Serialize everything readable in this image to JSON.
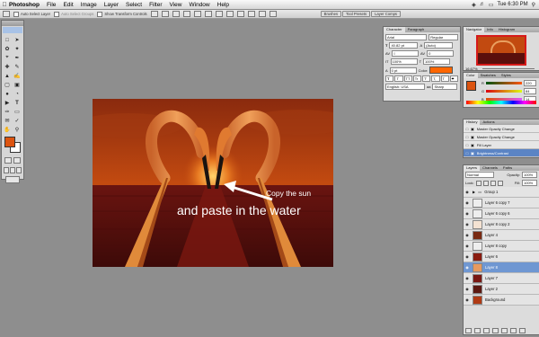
{
  "menubar": {
    "items": [
      "Photoshop",
      "File",
      "Edit",
      "Image",
      "Layer",
      "Select",
      "Filter",
      "View",
      "Window",
      "Help"
    ],
    "clock": "Tue 6:30 PM"
  },
  "optbar": {
    "auto_select_layer": "Auto Select Layer",
    "auto_select_groups": "Auto Select Groups",
    "show_transform": "Show Transform Controls",
    "wells": [
      "Brushes",
      "Tool Presets",
      "Layer Comps"
    ]
  },
  "canvas": {
    "colors": {
      "sky": "#c24a10",
      "water": "#5a0f0c",
      "flamingo": "#e88a3a"
    },
    "caption1": "Copy the sun",
    "caption2": "and paste in the water"
  },
  "character": {
    "tabs": [
      "Character",
      "Paragraph"
    ],
    "font": "Arial",
    "style": "Regular",
    "size": "40.82 pt",
    "leading": "(Auto)",
    "tracking": "0",
    "kerning": "0",
    "scale_v": "100%",
    "scale_h": "100%",
    "baseline": "0 pt",
    "color_label": "Color:",
    "color": "#ff6600",
    "language": "English: USA",
    "antialias": "Sharp",
    "style_buttons": [
      "T",
      "T",
      "TT",
      "Tr",
      "T'",
      "T,",
      "T",
      "T"
    ]
  },
  "navigator": {
    "tabs": [
      "Navigator",
      "Info",
      "Histogram"
    ],
    "zoom": "16.67%"
  },
  "color_panel": {
    "tabs": [
      "Color",
      "Swatches",
      "Styles"
    ],
    "channels": [
      {
        "label": "R",
        "value": "220"
      },
      {
        "label": "G",
        "value": "84"
      },
      {
        "label": "B",
        "value": "14"
      }
    ],
    "fg": "#dc5410"
  },
  "history": {
    "tabs": [
      "History",
      "Actions"
    ],
    "items": [
      {
        "label": "Master Opacity Change",
        "selected": false
      },
      {
        "label": "Master Opacity Change",
        "selected": false
      },
      {
        "label": "Fill Layer",
        "selected": false
      },
      {
        "label": "Brightness/Contrast",
        "selected": true
      }
    ]
  },
  "layers": {
    "tabs": [
      "Layers",
      "Channels",
      "Paths"
    ],
    "blend": "Normal",
    "opacity_label": "Opacity:",
    "opacity": "100%",
    "lock_label": "Lock:",
    "fill_label": "Fill:",
    "fill": "100%",
    "rows": [
      {
        "name": "Group 1",
        "kind": "group",
        "selected": false,
        "thumb": "#f0f0f0"
      },
      {
        "name": "Layer 6 copy 7",
        "kind": "layer",
        "selected": false,
        "thumb": "#eeeeee"
      },
      {
        "name": "Layer 6 copy 6",
        "kind": "layer",
        "selected": false,
        "thumb": "#eeeeee"
      },
      {
        "name": "Layer 8 copy 2",
        "kind": "layer",
        "selected": false,
        "thumb": "#f4e2d2"
      },
      {
        "name": "Layer 4",
        "kind": "layer",
        "selected": false,
        "thumb": "#7a2a12"
      },
      {
        "name": "Layer 8 copy",
        "kind": "layer",
        "selected": false,
        "thumb": "#eeeeee"
      },
      {
        "name": "Layer 6",
        "kind": "layer",
        "selected": false,
        "thumb": "#8a1c10"
      },
      {
        "name": "Layer 8",
        "kind": "layer",
        "selected": true,
        "thumb": "#e79a5e"
      },
      {
        "name": "Layer 7",
        "kind": "layer",
        "selected": false,
        "thumb": "#7a1812"
      },
      {
        "name": "Layer 2",
        "kind": "layer",
        "selected": false,
        "thumb": "#5c1810"
      },
      {
        "name": "Background",
        "kind": "layer",
        "selected": false,
        "thumb": "#b03a14"
      }
    ]
  }
}
